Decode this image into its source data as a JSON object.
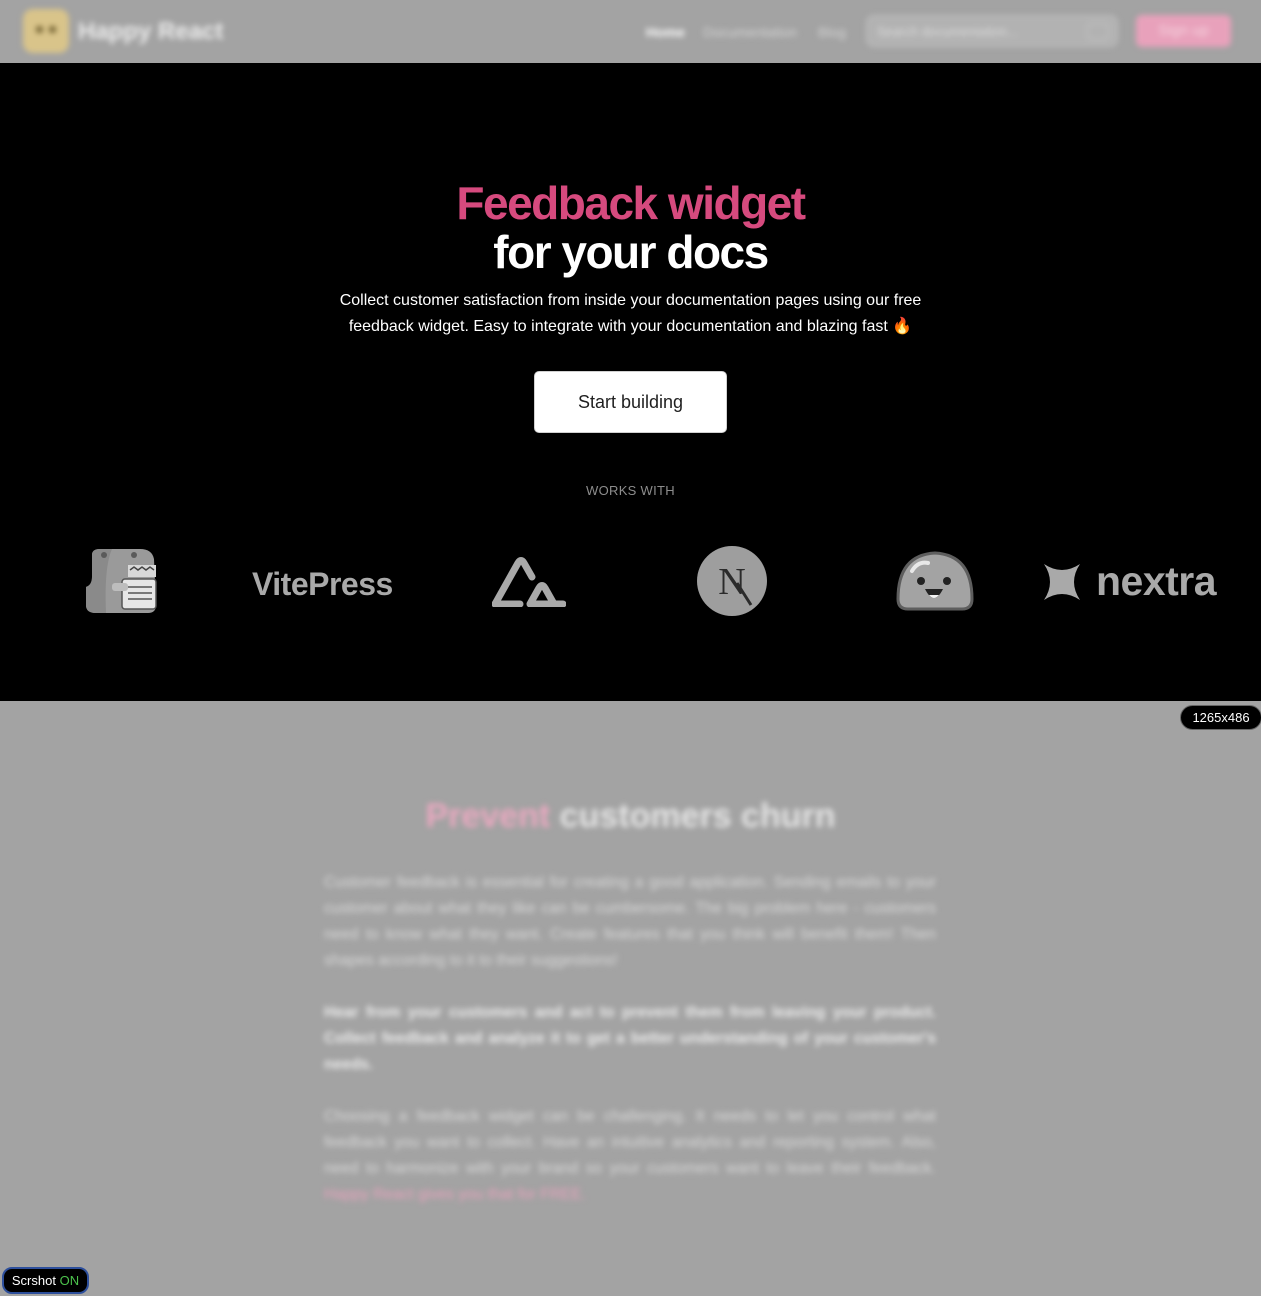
{
  "header": {
    "brand": "Happy React",
    "nav": {
      "home": "Home",
      "documentation": "Documentation",
      "blog": "Blog"
    },
    "search_placeholder": "Search documentation...",
    "signup": "Sign up",
    "logo_icon": "happy-cat-logo-icon"
  },
  "hero": {
    "title_line1": "Feedback widget",
    "title_line2": "for your docs",
    "subtitle": "Collect customer satisfaction from inside your documentation pages using our free feedback widget. Easy to integrate with your documentation and blazing fast",
    "fire_emoji": "🔥",
    "cta": "Start building",
    "works_with": "WORKS WITH",
    "frameworks": {
      "docusaurus_icon": "docusaurus-dinosaur-icon",
      "vitepress": "VitePress",
      "nuxt_icon": "nuxt-mountain-icon",
      "next_letter": "N",
      "blob_icon": "happy-blob-icon",
      "nextra": "nextra"
    },
    "accent_color": "#d64a7e"
  },
  "size_tag": "1265x486",
  "lower": {
    "title_accent": "Prevent",
    "title_rest": "customers churn",
    "p1": "Customer feedback is essential for creating a good application. Sending emails to your customer about what they like can be cumbersome. The big problem here - customers need to know what they want. Create features that you think will benefit them! Then shapes according to it to their suggestions!",
    "p2": "Hear from your customers and act to prevent them from leaving your product. Collect feedback and analyze it to get a better understanding of your customer's needs.",
    "p3": "Choosing a feedback widget can be challenging. It needs to let you control what feedback you want to collect. Have an intuitive analytics and reporting system. Also, need to harmonize with your brand so your customers want to leave their feedback.",
    "p3_link": "Happy React gives you that for FREE."
  },
  "scrshot": {
    "label": "Scrshot",
    "state": "ON"
  }
}
